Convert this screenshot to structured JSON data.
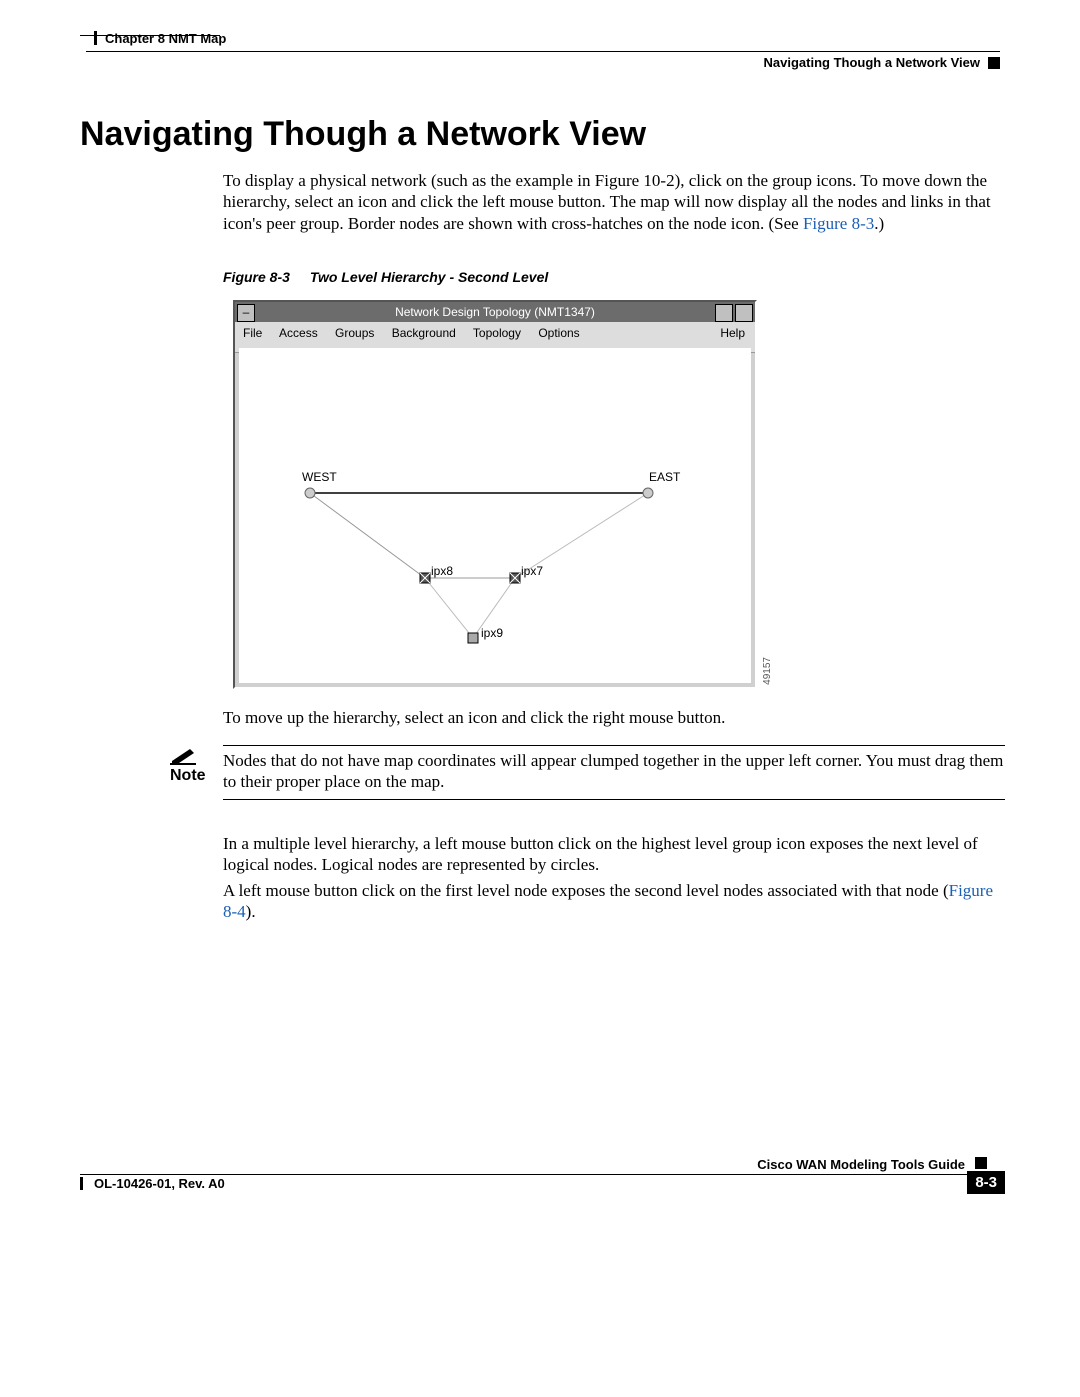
{
  "header": {
    "chapter_line": "Chapter 8     NMT Map",
    "section_title": "Navigating Though a Network View"
  },
  "title": "Navigating Though a Network View",
  "paragraphs": {
    "p1_a": "To display a physical network (such as the example in Figure 10-2), click on the group icons. To move down the hierarchy, select an icon and click the left mouse button. The map will now display all the nodes and links in that icon's peer group. Border nodes are shown with cross-hatches on the node icon. (See ",
    "p1_link": "Figure 8-3",
    "p1_b": ".)",
    "p2": "To move up the hierarchy, select an icon and click the right mouse button.",
    "p3": "In a multiple level hierarchy, a left mouse button click on the highest level group icon exposes the next level of logical nodes. Logical nodes are represented by circles.",
    "p4_a": "A left mouse button click on the first level node exposes the second level nodes associated with that node (",
    "p4_link": "Figure 8-4",
    "p4_b": ")."
  },
  "note": {
    "label": "Note",
    "text": "Nodes that do not have map coordinates will appear clumped together in the upper left corner. You must drag them to their proper place on the map."
  },
  "figure": {
    "caption_num": "Figure 8-3",
    "caption_text": "Two Level Hierarchy - Second Level",
    "window_title": "Network Design Topology (NMT1347)",
    "menu": {
      "file": "File",
      "access": "Access",
      "groups": "Groups",
      "background": "Background",
      "topology": "Topology",
      "options": "Options",
      "help": "Help"
    },
    "nodes": {
      "west": "WEST",
      "east": "EAST",
      "ipx8": "ipx8",
      "ipx7": "ipx7",
      "ipx9": "ipx9"
    },
    "id": "49157"
  },
  "footer": {
    "book_title": "Cisco WAN Modeling Tools Guide",
    "doc_id": "OL-10426-01, Rev. A0",
    "page": "8-3"
  }
}
